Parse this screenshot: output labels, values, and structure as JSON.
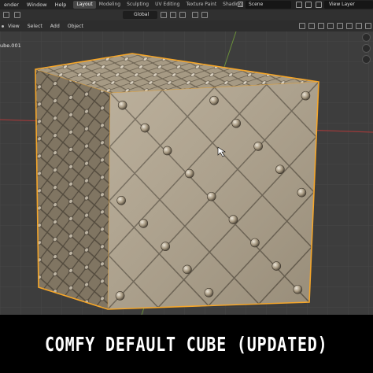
{
  "menubar": {
    "items": [
      "ender",
      "Window",
      "Help"
    ],
    "workspace_tabs": [
      "Layout",
      "Modeling",
      "Sculpting",
      "UV Editing",
      "Texture Paint",
      "Shading"
    ],
    "scene": "Scene",
    "view_layer": "View Layer"
  },
  "viewport_header": {
    "transform_orientation": "Global"
  },
  "viewport_menu": {
    "items": [
      "View",
      "Select",
      "Add",
      "Object"
    ]
  },
  "viewport": {
    "object_name": "ube.001"
  },
  "caption": {
    "text": "COMFY DEFAULT CUBE (UPDATED)"
  },
  "colors": {
    "selection_outline": "#f5a62a",
    "axis_x": "#9b3a3a",
    "axis_y": "#6b8f3b",
    "cube_base": "#b2a58e",
    "button": "#a89a82"
  }
}
